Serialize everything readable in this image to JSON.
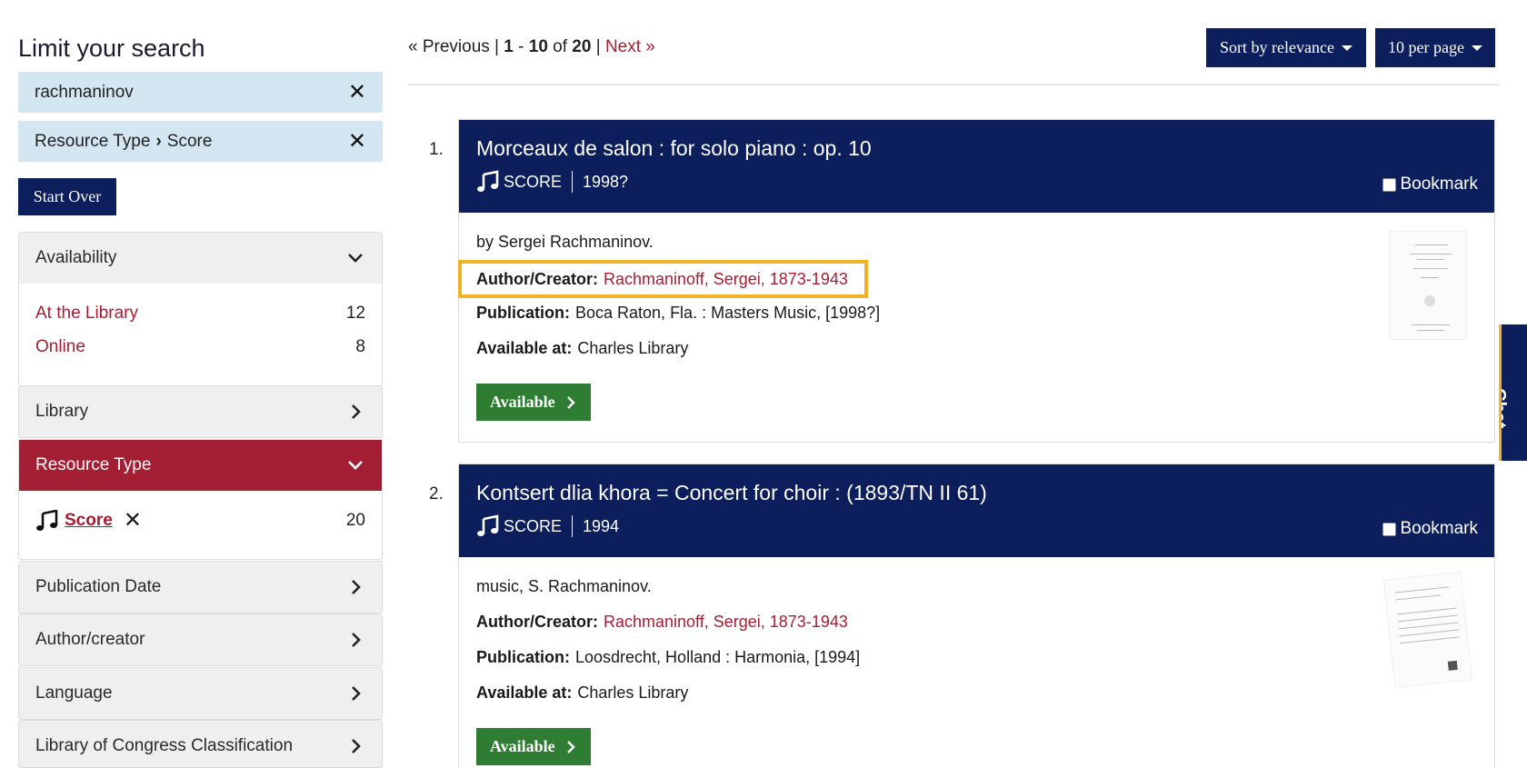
{
  "sidebar": {
    "title": "Limit your search",
    "constraints": [
      {
        "label": "rachmaninov"
      },
      {
        "field": "Resource Type",
        "value": "Score"
      }
    ],
    "start_over": "Start Over",
    "facets": {
      "availability": {
        "label": "Availability",
        "items": [
          {
            "label": "At the Library",
            "count": "12"
          },
          {
            "label": "Online",
            "count": "8"
          }
        ]
      },
      "library": {
        "label": "Library"
      },
      "resource_type": {
        "label": "Resource Type",
        "selected": {
          "label": "Score",
          "count": "20"
        }
      },
      "publication_date": {
        "label": "Publication Date"
      },
      "author_creator": {
        "label": "Author/creator"
      },
      "language": {
        "label": "Language"
      },
      "loc": {
        "label": "Library of Congress Classification"
      }
    }
  },
  "pager": {
    "prev": "« Previous",
    "sep": " | ",
    "start": "1",
    "dash": " - ",
    "end": "10",
    "of": " of ",
    "total": "20",
    "next": "Next »"
  },
  "sort": {
    "label": "Sort by relevance"
  },
  "per_page": {
    "label": "10 per page"
  },
  "results": [
    {
      "num": "1.",
      "title": "Morceaux de salon : for solo piano : op. 10",
      "format": "SCORE",
      "year": "1998?",
      "bookmark": "Bookmark",
      "statement": "by Sergei Rachmaninov.",
      "author_label": "Author/Creator:",
      "author": "Rachmaninoff, Sergei, 1873-1943",
      "pub_label": "Publication:",
      "publication": "Boca Raton, Fla. : Masters Music, [1998?]",
      "avail_label": "Available at:",
      "available_at": "Charles Library",
      "button": "Available"
    },
    {
      "num": "2.",
      "title": "Kontsert dlia khora = Concert for choir : (1893/TN II 61)",
      "format": "SCORE",
      "year": "1994",
      "bookmark": "Bookmark",
      "statement": "music, S. Rachmaninov.",
      "author_label": "Author/Creator:",
      "author": "Rachmaninoff, Sergei, 1873-1943",
      "pub_label": "Publication:",
      "publication": "Loosdrecht, Holland : Harmonia, [1994]",
      "avail_label": "Available at:",
      "available_at": "Charles Library",
      "button": "Available"
    }
  ],
  "chat": {
    "label": "Chat"
  },
  "colors": {
    "navy": "#0c1e5b",
    "crimson": "#a41e34",
    "green": "#2f7d32",
    "highlight": "#f0b323",
    "constraint_bg": "#d3e6f1"
  },
  "icons": [
    "close-icon",
    "chevron-down-icon",
    "chevron-right-icon",
    "music-note-icon",
    "arrow-right-icon"
  ]
}
